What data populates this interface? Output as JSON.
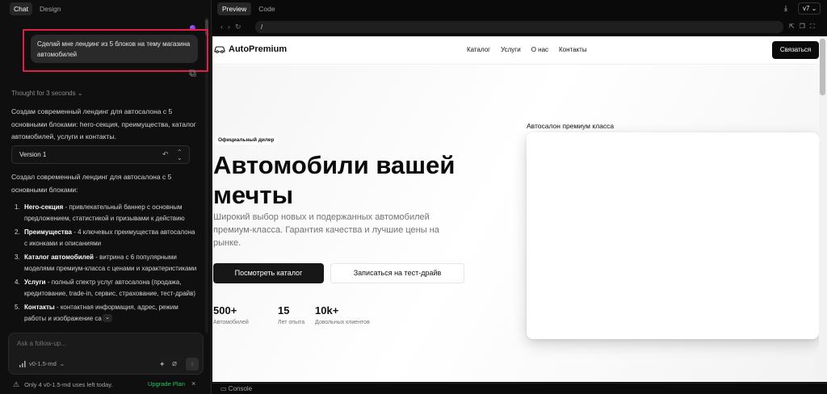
{
  "left_panel": {
    "tabs": [
      "Chat",
      "Design"
    ],
    "user_message": "Сделай мне лендинг из 5 блоков на тему магазина автомобилей",
    "thought": "Thought for 3 seconds",
    "intro": "Создам современный лендинг для автосалона с 5 основными блоками: hero-секция, преимущества, каталог автомобилей, услуги и контакты.",
    "version_label": "Version 1",
    "summary": "Создал современный лендинг для автосалона с 5 основными блоками:",
    "list": [
      {
        "num": "1.",
        "title": "Hero-секция",
        "text": " - привлекательный баннер с основным предложением, статистикой и призывами к действию"
      },
      {
        "num": "2.",
        "title": "Преимущества",
        "text": " - 4 ключевых преимущества автосалона с иконками и описаниями"
      },
      {
        "num": "3.",
        "title": "Каталог автомобилей",
        "text": " - витрина с 6 популярными моделями премиум-класса с ценами и характеристиками"
      },
      {
        "num": "4.",
        "title": "Услуги",
        "text": " - полный спектр услуг автосалона (продажа, кредитование, trade-in, сервис, страхование, тест-драйв)"
      },
      {
        "num": "5.",
        "title": "Контакты",
        "text": " - контактная информация, адрес, режим работы и изображение са"
      }
    ],
    "composer_placeholder": "Ask a follow-up...",
    "model": "v0-1.5-md",
    "usage_text": "Only 4 v0-1.5-md uses left today.",
    "upgrade_label": "Upgrade Plan"
  },
  "right_panel": {
    "tabs": [
      "Preview",
      "Code"
    ],
    "version": "v7",
    "url": "/",
    "console_label": "Console"
  },
  "site": {
    "brand": "AutoPremium",
    "nav": [
      "Каталог",
      "Услуги",
      "О нас",
      "Контакты"
    ],
    "contact_button": "Связаться",
    "badge": "Официальный дилер",
    "title": "Автомобили вашей мечты",
    "subtitle": "Широкий выбор новых и подержанных автомобилей премиум-класса. Гарантия качества и лучшие цены на рынке.",
    "primary_button": "Посмотреть каталог",
    "secondary_button": "Записаться на тест-драйв",
    "stats": [
      {
        "value": "500+",
        "label": "Автомобилей"
      },
      {
        "value": "15",
        "label": "Лет опыта"
      },
      {
        "value": "10k+",
        "label": "Довольных клиентов"
      }
    ],
    "card_label": "Автосалон премиум класса"
  },
  "colors": {
    "accent_highlight": "#e11d48",
    "upgrade_green": "#22c55e"
  }
}
